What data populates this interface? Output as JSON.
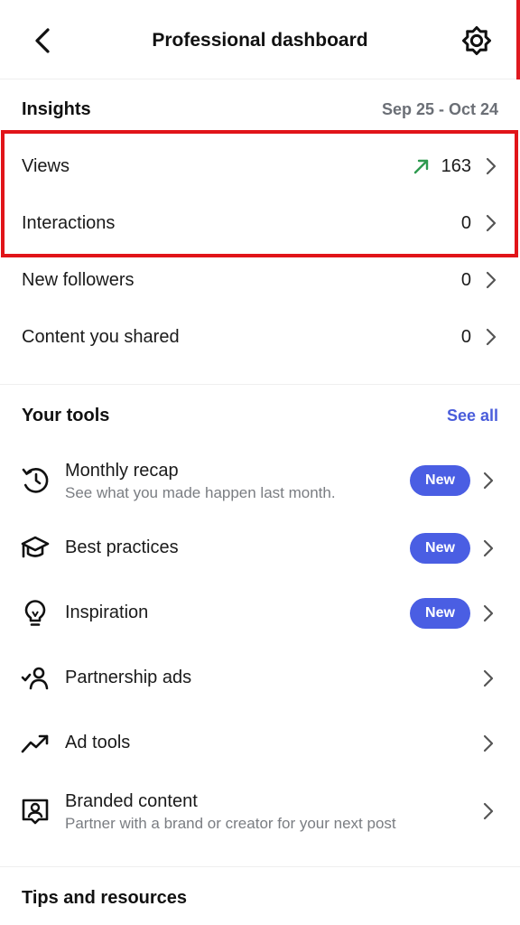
{
  "header": {
    "title": "Professional dashboard",
    "back_icon": "back-arrow-icon",
    "settings_icon": "gear-icon"
  },
  "insights": {
    "title": "Insights",
    "date_range": "Sep 25 - Oct 24",
    "rows": [
      {
        "label": "Views",
        "value": "163",
        "trend": "up"
      },
      {
        "label": "Interactions",
        "value": "0"
      },
      {
        "label": "New followers",
        "value": "0"
      },
      {
        "label": "Content you shared",
        "value": "0"
      }
    ]
  },
  "tools": {
    "title": "Your tools",
    "see_all": "See all",
    "items": [
      {
        "label": "Monthly recap",
        "subtitle": "See what you made happen last month.",
        "badge": "New",
        "icon": "history-clock-icon"
      },
      {
        "label": "Best practices",
        "badge": "New",
        "icon": "graduation-cap-icon"
      },
      {
        "label": "Inspiration",
        "badge": "New",
        "icon": "lightbulb-icon"
      },
      {
        "label": "Partnership ads",
        "icon": "person-check-icon"
      },
      {
        "label": "Ad tools",
        "icon": "trend-up-icon"
      },
      {
        "label": "Branded content",
        "subtitle": "Partner with a brand or creator for your next post",
        "icon": "branded-content-icon"
      }
    ]
  },
  "tips": {
    "title": "Tips and resources"
  },
  "colors": {
    "accent": "#4a5ee3",
    "link": "#4a5ddb",
    "trend_up": "#2e9a4f",
    "highlight": "#e11419"
  }
}
